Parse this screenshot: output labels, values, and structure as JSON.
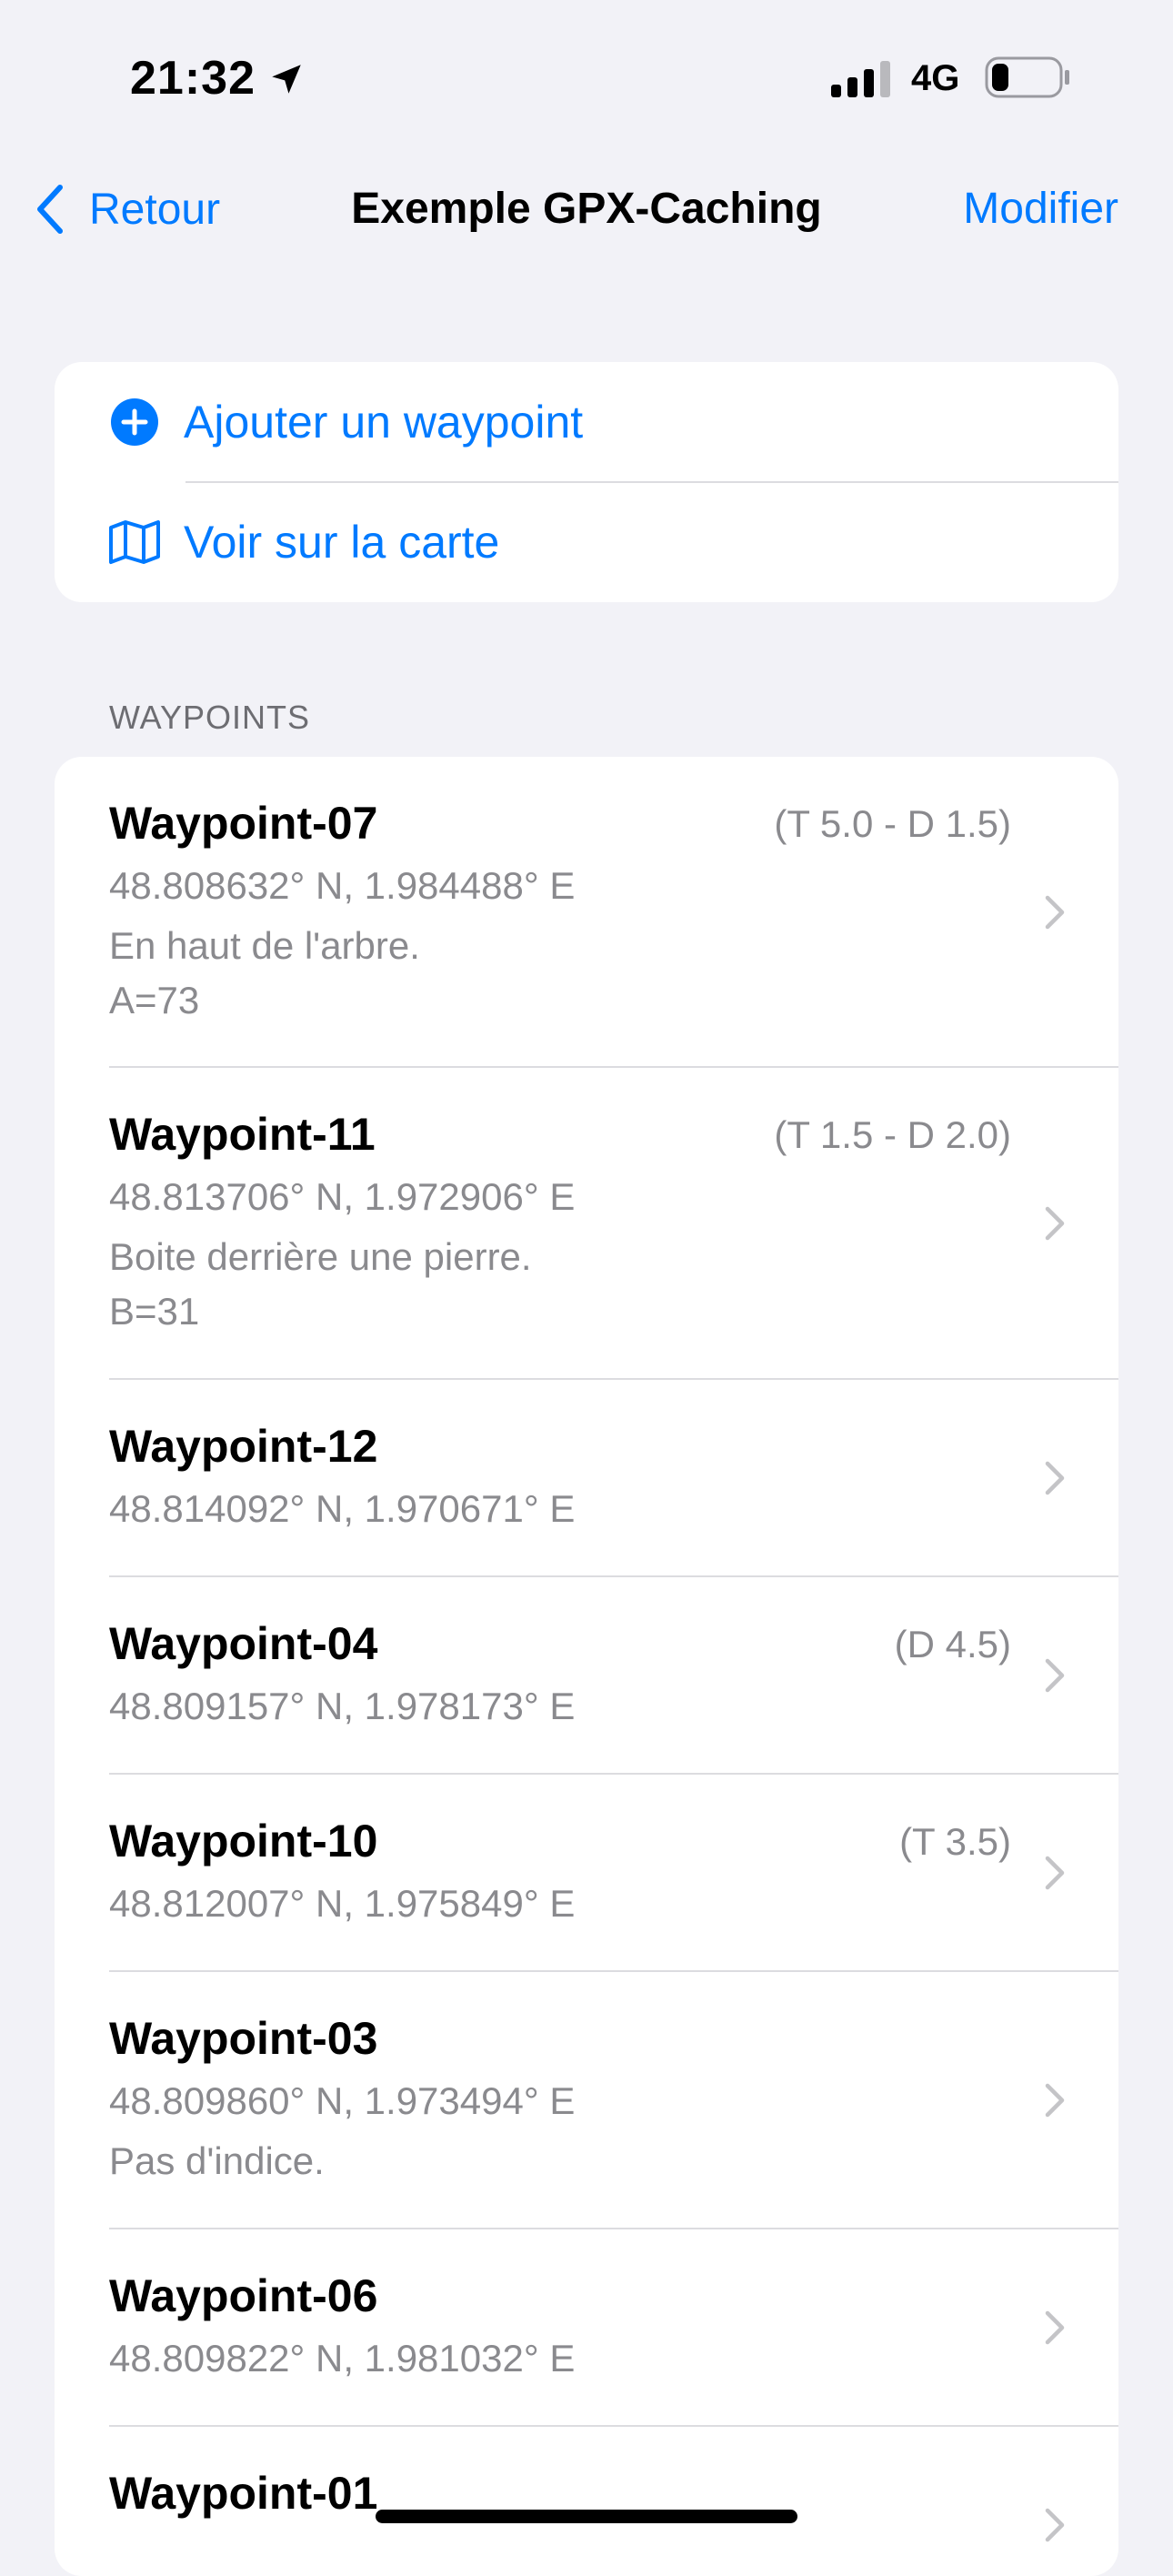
{
  "status_bar": {
    "time": "21:32",
    "network": "4G",
    "icons": [
      "location-arrow-icon",
      "signal-icon",
      "battery-icon"
    ]
  },
  "nav": {
    "back_label": "Retour",
    "title": "Exemple GPX-Caching",
    "edit_label": "Modifier"
  },
  "actions": [
    {
      "label": "Ajouter un waypoint",
      "icon": "plus-circle-icon"
    },
    {
      "label": "Voir sur la carte",
      "icon": "map-icon"
    }
  ],
  "section_header": "WAYPOINTS",
  "waypoints": [
    {
      "name": "Waypoint-07",
      "badge": "(T 5.0 - D 1.5)",
      "coords": "48.808632° N, 1.984488° E",
      "lines": [
        "En haut de l'arbre.",
        "A=73"
      ]
    },
    {
      "name": "Waypoint-11",
      "badge": "(T 1.5 - D 2.0)",
      "coords": "48.813706° N, 1.972906° E",
      "lines": [
        "Boite derrière une pierre.",
        "B=31"
      ]
    },
    {
      "name": "Waypoint-12",
      "badge": "",
      "coords": "48.814092° N, 1.970671° E",
      "lines": []
    },
    {
      "name": "Waypoint-04",
      "badge": "(D 4.5)",
      "coords": "48.809157° N, 1.978173° E",
      "lines": []
    },
    {
      "name": "Waypoint-10",
      "badge": "(T 3.5)",
      "coords": "48.812007° N, 1.975849° E",
      "lines": []
    },
    {
      "name": "Waypoint-03",
      "badge": "",
      "coords": "48.809860° N, 1.973494° E",
      "lines": [
        "Pas d'indice."
      ]
    },
    {
      "name": "Waypoint-06",
      "badge": "",
      "coords": "48.809822° N, 1.981032° E",
      "lines": []
    },
    {
      "name": "Waypoint-01",
      "badge": "",
      "coords": "",
      "lines": []
    }
  ],
  "colors": {
    "accent": "#007aff",
    "background": "#f2f2f7",
    "secondary_text": "#8a8a8e"
  }
}
